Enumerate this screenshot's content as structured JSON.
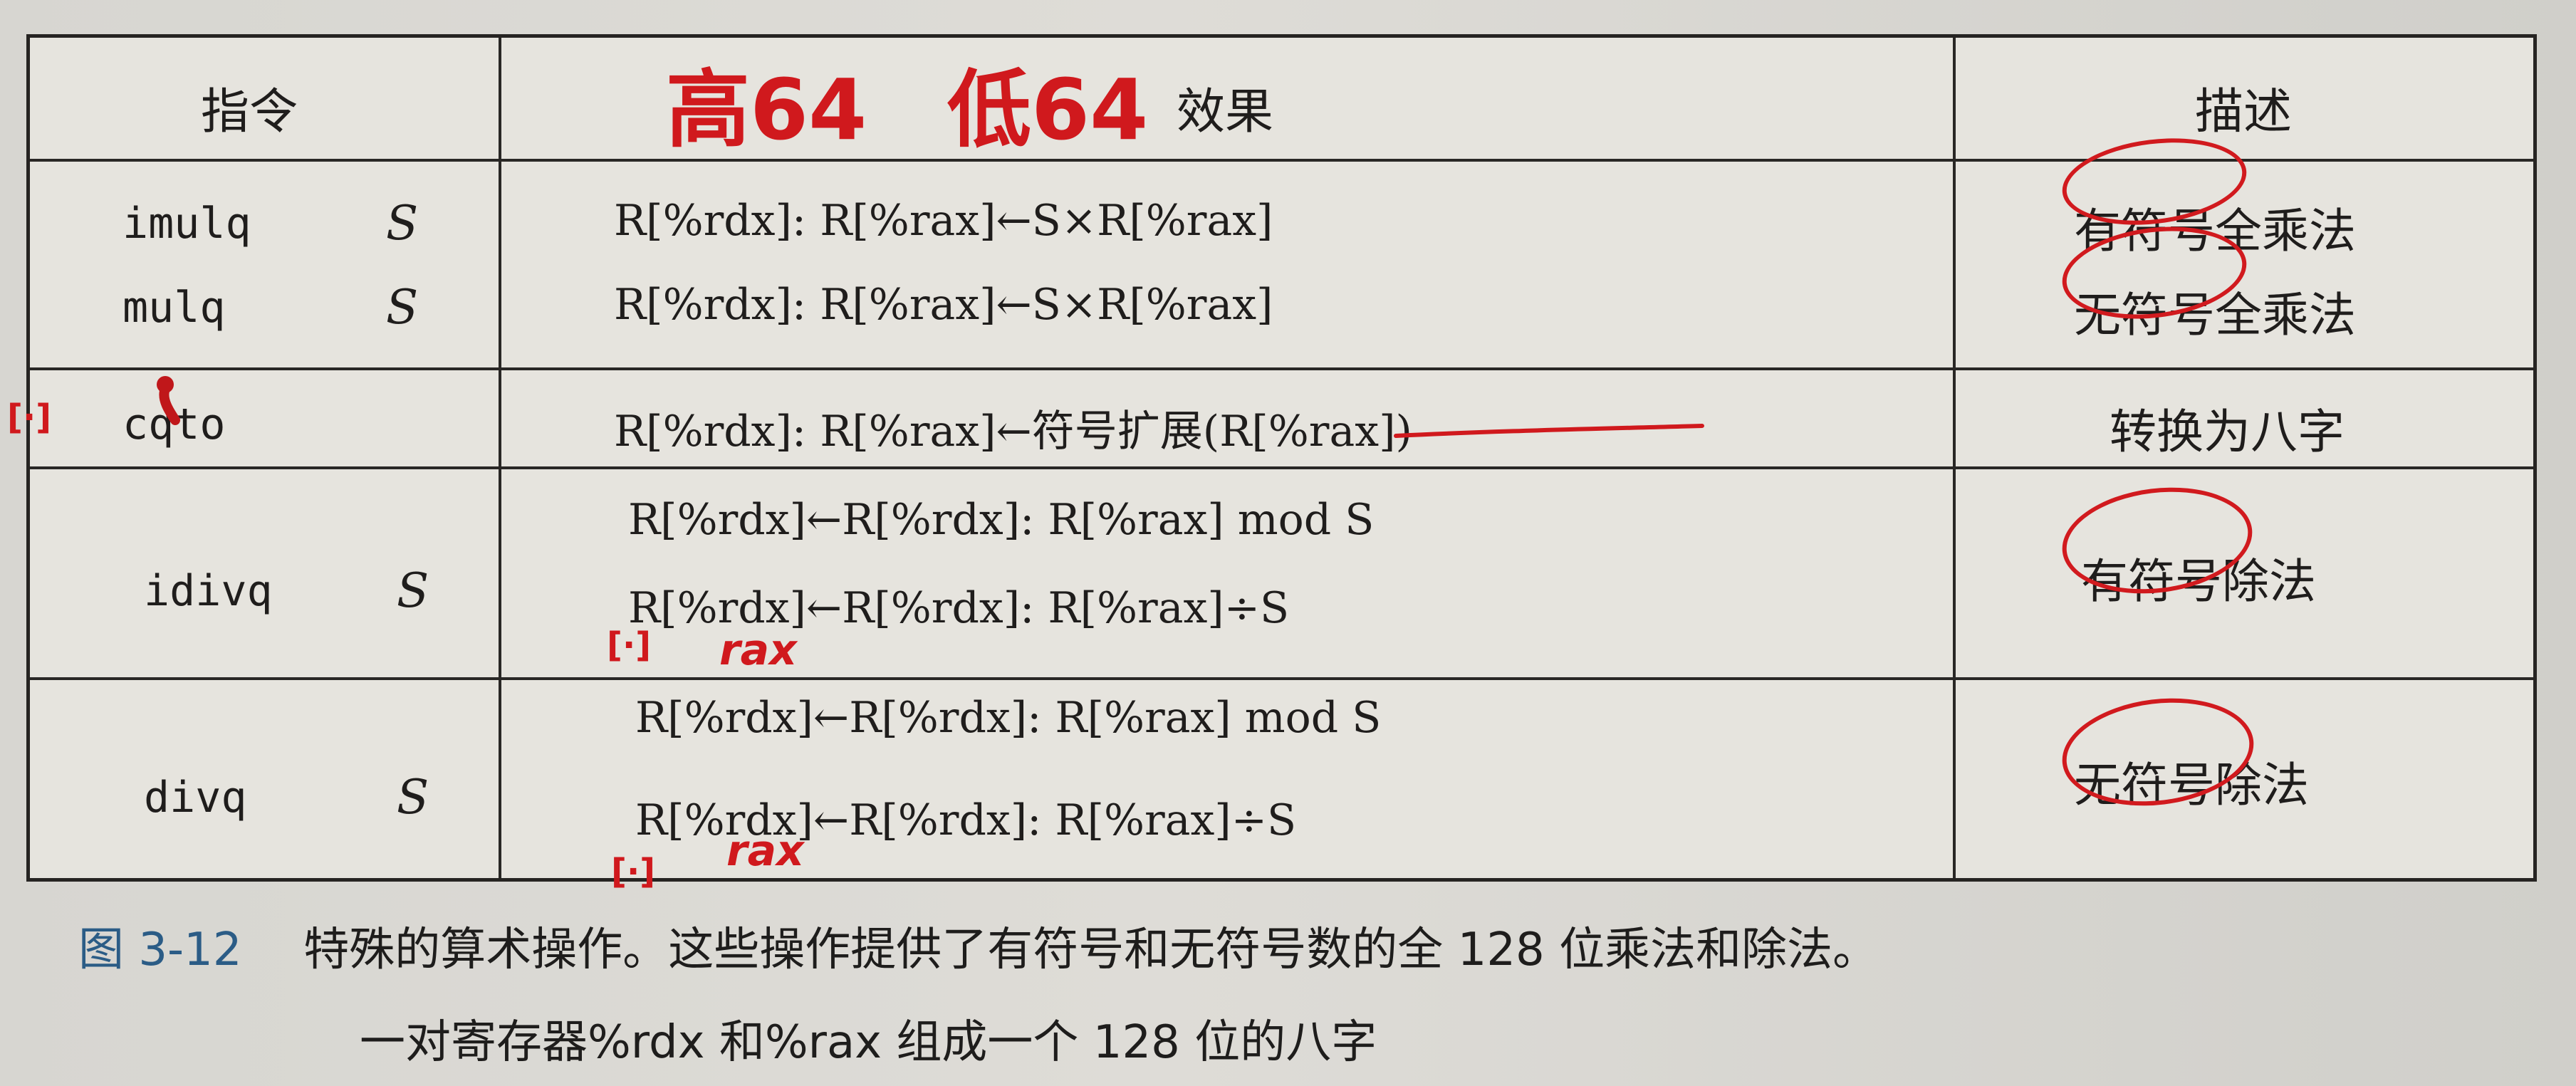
{
  "table": {
    "headers": {
      "instruction": "指令",
      "effect": "效果",
      "description": "描述"
    },
    "rows": [
      {
        "instr": "imulq",
        "operand": "S",
        "effect": "R[%rdx]: R[%rax]←S×R[%rax]",
        "desc": "有符号全乘法"
      },
      {
        "instr": "mulq",
        "operand": "S",
        "effect": "R[%rdx]: R[%rax]←S×R[%rax]",
        "desc": "无符号全乘法"
      },
      {
        "instr": "cqto",
        "operand": "",
        "effect": "R[%rdx]: R[%rax]←符号扩展(R[%rax])",
        "desc": "转换为八字"
      },
      {
        "instr": "idivq",
        "operand": "S",
        "effect_lines": [
          "R[%rdx]←R[%rdx]: R[%rax] mod S",
          "R[%rdx]←R[%rdx]: R[%rax]÷S"
        ],
        "desc": "有符号除法"
      },
      {
        "instr": "divq",
        "operand": "S",
        "effect_lines": [
          "R[%rdx]←R[%rdx]: R[%rax] mod S",
          "R[%rdx]←R[%rdx]: R[%rax]÷S"
        ],
        "desc": "无符号除法"
      }
    ]
  },
  "caption": {
    "number": "图 3-12",
    "line1": "特殊的算术操作。这些操作提供了有符号和无符号数的全 128 位乘法和除法。",
    "line2": "一对寄存器%rdx 和%rax 组成一个 128 位的八字"
  },
  "annotations": {
    "high64": "高64",
    "low64": "低64",
    "rax_note_1": "rax",
    "rax_note_2": "rax",
    "bracket_mark": "[·]",
    "ink_color": "#d0191d"
  }
}
